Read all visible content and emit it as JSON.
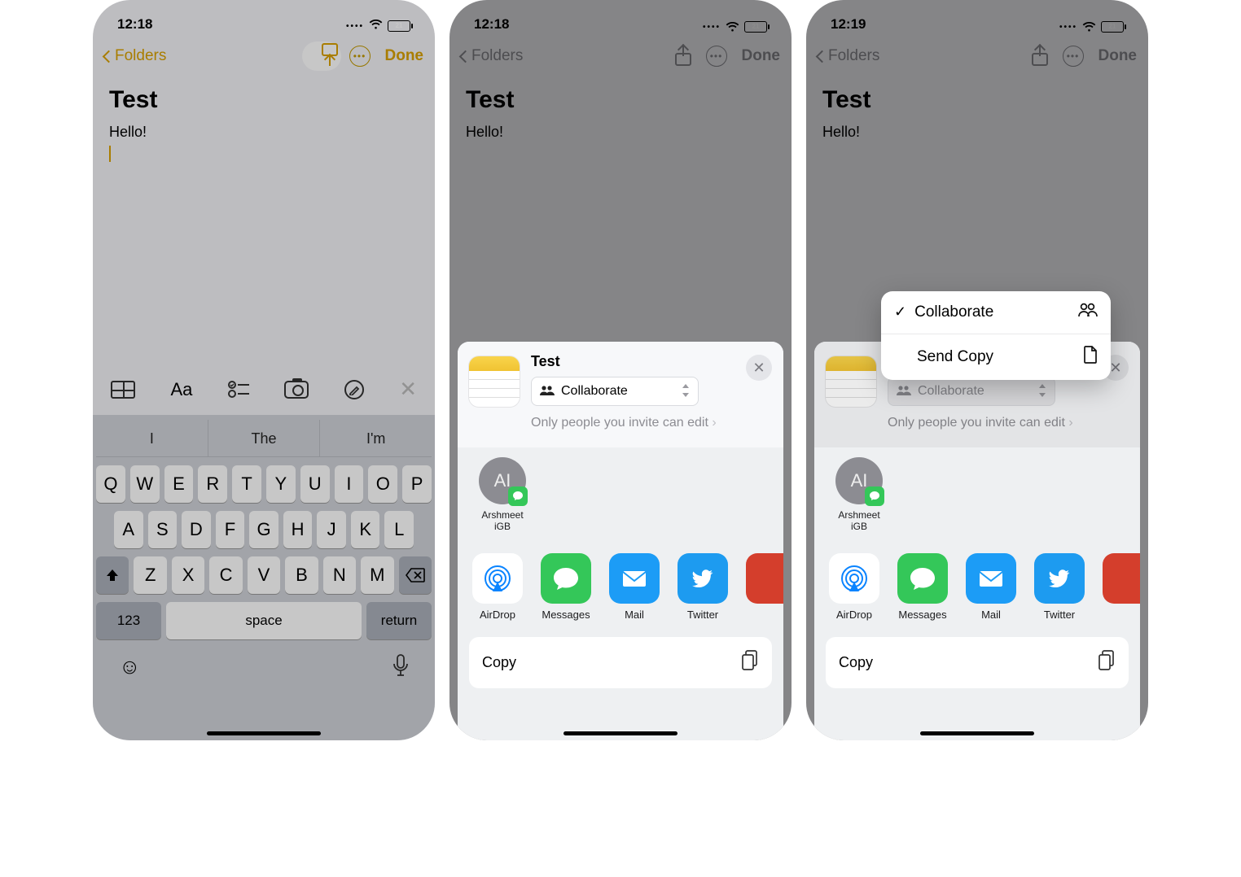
{
  "s1": {
    "time": "12:18",
    "battery": "21",
    "back": "Folders",
    "done": "Done",
    "title": "Test",
    "body": "Hello!",
    "suggest": [
      "I",
      "The",
      "I'm"
    ],
    "row1": [
      "Q",
      "W",
      "E",
      "R",
      "T",
      "Y",
      "U",
      "I",
      "O",
      "P"
    ],
    "row2": [
      "A",
      "S",
      "D",
      "F",
      "G",
      "H",
      "J",
      "K",
      "L"
    ],
    "row3": [
      "Z",
      "X",
      "C",
      "V",
      "B",
      "N",
      "M"
    ],
    "num": "123",
    "space": "space",
    "return": "return"
  },
  "s2": {
    "time": "12:18",
    "battery": "21",
    "back": "Folders",
    "done": "Done",
    "title": "Test",
    "body": "Hello!",
    "sheet_title": "Test",
    "collab": "Collaborate",
    "invite": "Only people you invite can edit",
    "contact_initials": "AI",
    "contact_name1": "Arshmeet",
    "contact_name2": "iGB",
    "apps": {
      "airdrop": "AirDrop",
      "messages": "Messages",
      "mail": "Mail",
      "twitter": "Twitter"
    },
    "copy": "Copy"
  },
  "s3": {
    "time": "12:19",
    "battery": "21",
    "back": "Folders",
    "done": "Done",
    "title": "Test",
    "body": "Hello!",
    "opt1": "Collaborate",
    "opt2": "Send Copy",
    "collab": "Collaborate",
    "invite": "Only people you invite can edit",
    "contact_initials": "AI",
    "contact_name1": "Arshmeet",
    "contact_name2": "iGB",
    "apps": {
      "airdrop": "AirDrop",
      "messages": "Messages",
      "mail": "Mail",
      "twitter": "Twitter"
    },
    "copy": "Copy"
  }
}
